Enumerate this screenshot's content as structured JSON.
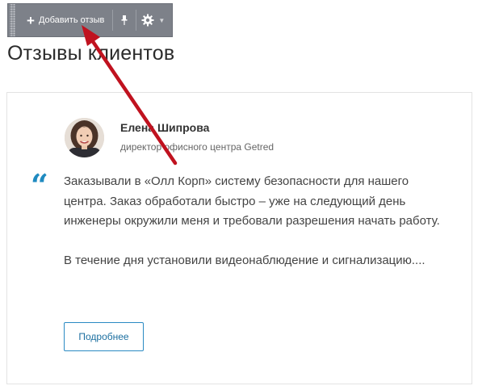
{
  "toolbar": {
    "add_label": "Добавить отзыв"
  },
  "page": {
    "title": "Отзывы клиентов"
  },
  "review": {
    "author_name": "Елена Шипрова",
    "author_role": "директор офисного центра Getred",
    "quote_mark": "“",
    "paragraphs": [
      "Заказывали в «Олл Корп» систему безопасности для нашего центра. Заказ обработали быстро – уже на следующий день инженеры окружили меня и требовали разрешения начать работу.",
      "В течение дня установили видеонаблюдение и сигнализацию...."
    ],
    "more_label": "Подробнее"
  },
  "colors": {
    "accent": "#1f8ac0",
    "toolbar_bg": "#7d8189",
    "annotation_arrow": "#c0121f"
  },
  "icons": [
    "plus-icon",
    "pin-icon",
    "gear-icon",
    "chevron-down-icon",
    "quote-icon"
  ]
}
